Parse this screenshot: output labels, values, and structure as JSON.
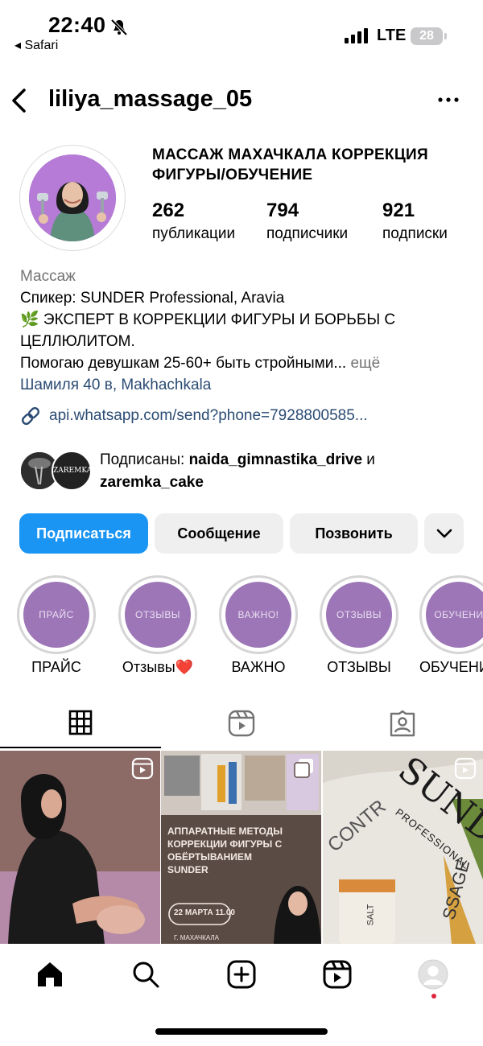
{
  "status_bar": {
    "time": "22:40",
    "back_app": "◂ Safari",
    "network": "LTE",
    "battery": "28"
  },
  "header": {
    "username": "liliya_massage_05"
  },
  "profile": {
    "name": "МАССАЖ МАХАЧКАЛА КОРРЕКЦИЯ ФИГУРЫ/ОБУЧЕНИЕ",
    "stats": [
      {
        "value": "262",
        "label": "публикации"
      },
      {
        "value": "794",
        "label": "подписчики"
      },
      {
        "value": "921",
        "label": "подписки"
      }
    ]
  },
  "bio": {
    "category": "Массаж",
    "line1": "Спикер: SUNDER Professional, Aravia",
    "line2": "🌿 ЭКСПЕРТ В КОРРЕКЦИИ ФИГУРЫ И БОРЬБЫ С ЦЕЛЛЮЛИТОМ.",
    "line3": "Помогаю девушкам 25-60+ быть стройными...",
    "more": " ещё",
    "location": "Шамиля 40 в, Makhachkala",
    "link": "api.whatsapp.com/send?phone=7928800585..."
  },
  "mutual": {
    "prefix": "Подписаны: ",
    "user1": "naida_gimnastika_drive",
    "joiner": " и ",
    "user2": "zaremka_cake",
    "avatar2_text": "ZAREMKA"
  },
  "buttons": {
    "follow": "Подписаться",
    "message": "Сообщение",
    "call": "Позвонить"
  },
  "highlights": [
    {
      "cover": "ПРАЙС",
      "title": "ПРАЙС"
    },
    {
      "cover": "ОТЗЫВЫ",
      "title": "Отзывы❤️"
    },
    {
      "cover": "ВАЖНО!",
      "title": "ВАЖНО"
    },
    {
      "cover": "ОТЗЫВЫ",
      "title": "ОТЗЫВЫ"
    },
    {
      "cover": "ОБУЧЕНИ",
      "title": "ОБУЧЕНИ"
    }
  ],
  "posts": [
    {
      "type": "reel"
    },
    {
      "type": "carousel",
      "heading": "АППАРАТНЫЕ МЕТОДЫ КОРРЕКЦИИ ФИГУРЫ С ОБЁРТЫВАНИЕМ SUNDER",
      "date": "22 МАРТА 11.00",
      "city": "Г. МАХАЧКАЛА"
    },
    {
      "type": "reel",
      "brand": "SUNDER",
      "sub": "PROFESSIONAL",
      "side1": "CONTR",
      "side2": "SSAGE",
      "jar": "SALT"
    }
  ],
  "colors": {
    "primary": "#1a95f3",
    "link": "#2b4b73",
    "highlight": "#9d76b7"
  }
}
